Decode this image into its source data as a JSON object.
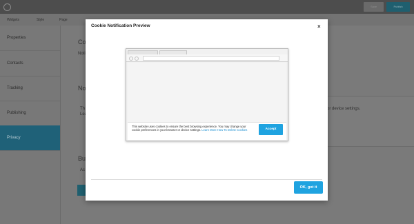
{
  "topbar": {
    "save_label": "Save",
    "publish_label": "Publish"
  },
  "tabs": [
    "Widgets",
    "Style",
    "Page"
  ],
  "sidebar": {
    "items": [
      {
        "label": "Properties"
      },
      {
        "label": "Contacts"
      },
      {
        "label": "Tracking"
      },
      {
        "label": "Publishing"
      },
      {
        "label": "Privacy"
      }
    ]
  },
  "background_content": {
    "heading_1": "Co",
    "small_1": "Noti",
    "heading_2": "No",
    "small_2": "Th",
    "small_3": "Lea",
    "side_text": "er or device settings.",
    "heading_3": "Bu",
    "small_4": "Ac"
  },
  "modal": {
    "title": "Cookie Notification Preview",
    "close_glyph": "×",
    "ok_label": "OK, got it"
  },
  "preview": {
    "cookie_text": "This website uses cookies to ensure the best browsing experience. You may change your cookie preferences in your browser or device settings.",
    "learn_more": "Learn More",
    "delete_link": "How To Delete Cookies",
    "accept_label": "Accept"
  },
  "colors": {
    "accent": "#1fa3e0",
    "active_sidebar": "#1f6178"
  }
}
